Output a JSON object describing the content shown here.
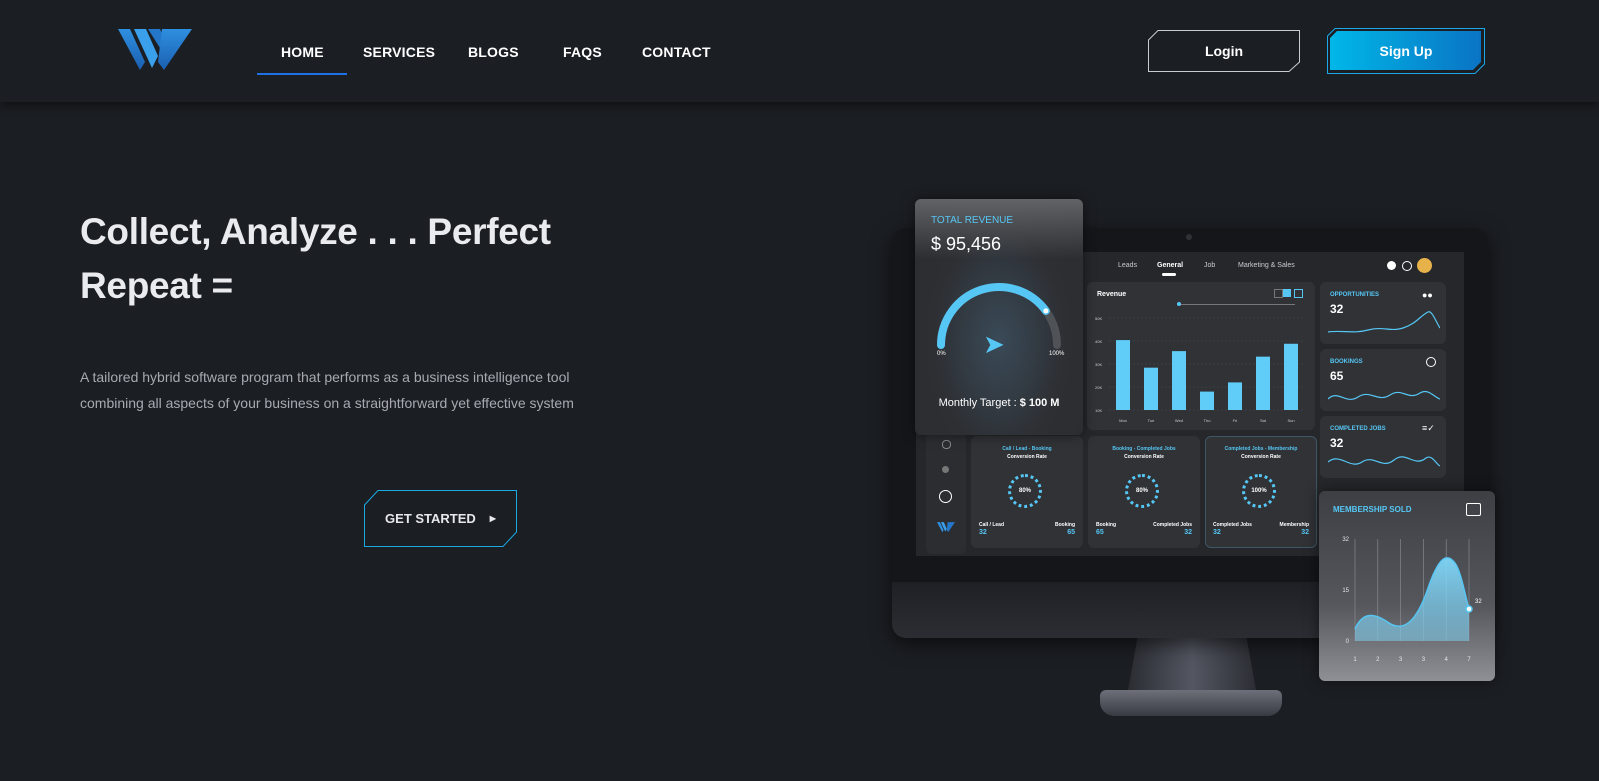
{
  "nav": {
    "items": [
      {
        "label": "HOME",
        "active": true
      },
      {
        "label": "SERVICES"
      },
      {
        "label": "BLOGS"
      },
      {
        "label": "FAQS"
      },
      {
        "label": "CONTACT"
      }
    ],
    "login_label": "Login",
    "signup_label": "Sign Up"
  },
  "hero": {
    "title_line1": "Collect, Analyze . . . Perfect",
    "title_line2": "Repeat =",
    "description": "A tailored hybrid software program that performs as a business intelligence tool combining all aspects of your business on a straightforward yet effective system",
    "cta_label": "GET STARTED"
  },
  "dashboard": {
    "tabs": [
      "Leads",
      "General",
      "Job",
      "Marketing & Sales"
    ],
    "active_tab": "General",
    "total_revenue": {
      "label": "TOTAL REVENUE",
      "value": "$ 95,456",
      "min_label": "0%",
      "max_label": "100%",
      "progress": 0.8,
      "target_label": "Monthly Target : ",
      "target_value": "$ 100 M"
    },
    "revenue_chart": {
      "title": "Revenue",
      "ylabels": [
        "50K",
        "40K",
        "30K",
        "20K",
        "10K"
      ],
      "categories": [
        "Mon",
        "Tue",
        "Wed",
        "Thu",
        "Fri",
        "Sat",
        "Sun"
      ],
      "values": [
        38,
        23,
        32,
        10,
        15,
        29,
        36
      ],
      "ymax": 50
    },
    "stats": [
      {
        "label": "OPPORTUNITIES",
        "value": "32",
        "icon": "users-icon"
      },
      {
        "label": "BOOKINGS",
        "value": "65",
        "icon": "target-icon"
      },
      {
        "label": "COMPLETED JOBS",
        "value": "32",
        "icon": "list-check-icon"
      }
    ],
    "conversions": [
      {
        "title": "Call / Lead - Booking",
        "subtitle": "Conversion Rate",
        "gauge": "80%",
        "left_label": "Call / Lead",
        "left_value": "32",
        "right_label": "Booking",
        "right_value": "65"
      },
      {
        "title": "Booking - Completed Jobs",
        "subtitle": "Conversion Rate",
        "gauge": "80%",
        "left_label": "Booking",
        "left_value": "65",
        "right_label": "Completed Jobs",
        "right_value": "32"
      },
      {
        "title": "Completed Jobs - Membership",
        "subtitle": "Conversion Rate",
        "gauge": "100%",
        "left_label": "Completed Jobs",
        "left_value": "32",
        "right_label": "Membership",
        "right_value": "32"
      }
    ],
    "membership": {
      "label": "MEMBERSHIP SOLD",
      "ylabels": [
        "32",
        "15",
        "0"
      ],
      "xlabels": [
        "1",
        "2",
        "3",
        "3",
        "4",
        "7"
      ],
      "end_value": "32"
    }
  },
  "colors": {
    "background": "#1b1e23",
    "accent": "#56c7f5",
    "signup": "#0b8fd6",
    "nav_underline": "#1f6fe6"
  }
}
